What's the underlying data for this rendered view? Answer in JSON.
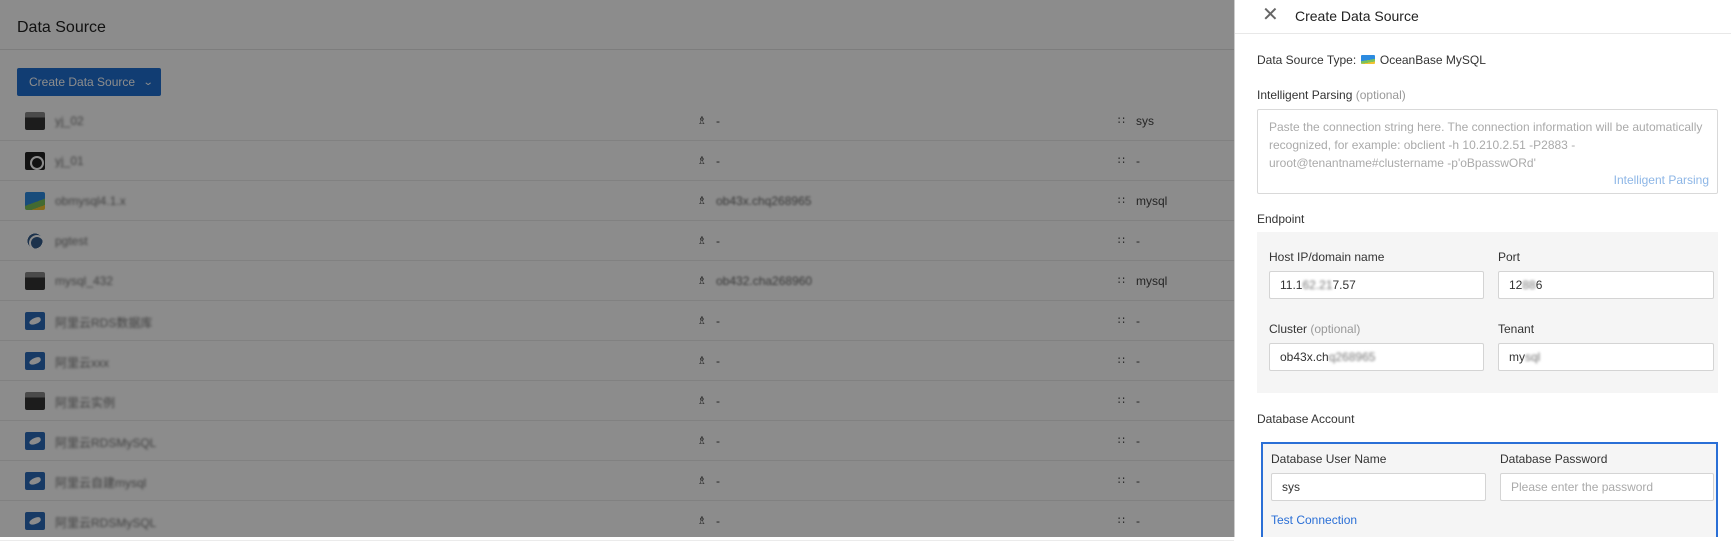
{
  "page": {
    "title": "Data Source",
    "create_button": "Create Data Source"
  },
  "rows": [
    {
      "icon": "folder-icon",
      "name": "yj_02",
      "cluster": "-",
      "tenant": "sys"
    },
    {
      "icon": "ring-icon",
      "name": "yj_01",
      "cluster": "-",
      "tenant": "-"
    },
    {
      "icon": "oceanbase-icon",
      "name": "obmysql4.1.x",
      "cluster": "ob43x.chq268965",
      "tenant": "mysql"
    },
    {
      "icon": "postgres-icon",
      "name": "pgtest",
      "cluster": "-",
      "tenant": "-"
    },
    {
      "icon": "folder-icon",
      "name": "mysql_432",
      "cluster": "ob432.cha268960",
      "tenant": "mysql"
    },
    {
      "icon": "dolphin-icon",
      "name": "阿里云RDS数据库",
      "cluster": "-",
      "tenant": "-"
    },
    {
      "icon": "dolphin-icon",
      "name": "阿里云xxx",
      "cluster": "-",
      "tenant": "-"
    },
    {
      "icon": "folder-icon",
      "name": "阿里云实例",
      "cluster": "-",
      "tenant": "-"
    },
    {
      "icon": "dolphin-icon",
      "name": "阿里云RDSMySQL",
      "cluster": "-",
      "tenant": "-"
    },
    {
      "icon": "dolphin-icon",
      "name": "阿里云自建mysql",
      "cluster": "-",
      "tenant": "-"
    },
    {
      "icon": "dolphin-icon",
      "name": "阿里云RDSMySQL",
      "cluster": "-",
      "tenant": "-"
    }
  ],
  "drawer": {
    "title": "Create Data Source",
    "type_label": "Data Source Type:",
    "type_value": "OceanBase MySQL",
    "parsing_label": "Intelligent Parsing",
    "optional": "(optional)",
    "parsing_placeholder": "Paste the connection string here. The connection information will be automatically recognized, for example: obclient -h 10.210.2.51 -P2883 -uroot@tenantname#clustername -p'oBpasswORd'",
    "parsing_link": "Intelligent Parsing",
    "endpoint_label": "Endpoint",
    "host_label": "Host IP/domain name",
    "host_value_prefix": "11.1",
    "host_value_blur": "62.21",
    "host_value_suffix": "7.57",
    "port_label": "Port",
    "port_value_prefix": "12",
    "port_value_blur": "88",
    "port_value_suffix": "6",
    "cluster_label": "Cluster",
    "cluster_value_prefix": "ob43x.ch",
    "cluster_value_blur": "q268965",
    "tenant_label": "Tenant",
    "tenant_value_prefix": "my",
    "tenant_value_blur": "sql",
    "account_label": "Database Account",
    "username_label": "Database User Name",
    "username_value": "sys",
    "password_label": "Database Password",
    "password_placeholder": "Please enter the password",
    "test_link": "Test Connection"
  },
  "colors": {
    "primary": "#1f6fd1",
    "overlay": "rgba(0,0,0,0.45)",
    "link": "#2a6fd6"
  }
}
